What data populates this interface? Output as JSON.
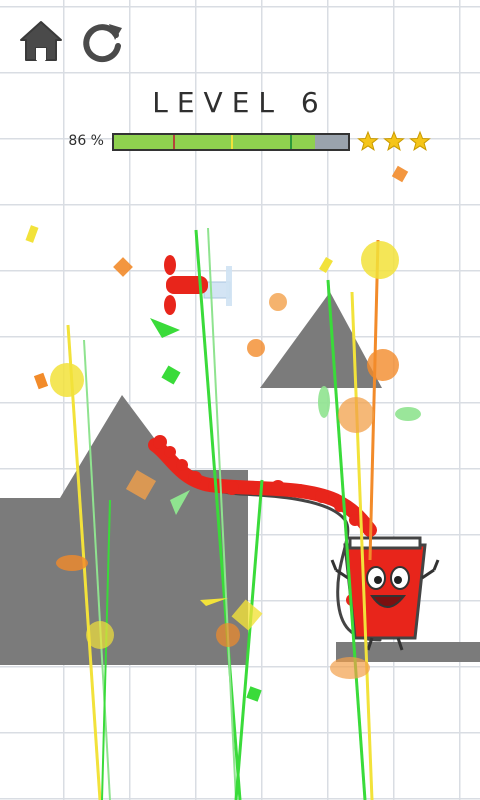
{
  "header": {
    "home_icon": "home-icon",
    "restart_icon": "restart-icon"
  },
  "level": {
    "title": "LEVEL 6"
  },
  "progress": {
    "label": "86 %",
    "fill_fraction": 0.86,
    "fill_color": "#8fd14f",
    "star_thresholds": [
      0.25,
      0.5,
      0.75
    ],
    "threshold_colors": [
      "#b5443a",
      "#f2e23a",
      "#2c9a3a"
    ],
    "stars_earned": 3,
    "stars_total": 3,
    "star_color": "#f5c518"
  },
  "colors": {
    "ground": "#7b7b7b",
    "liquid": "#e8251b",
    "cup": "#e8251b",
    "tap": "#e8251b"
  }
}
